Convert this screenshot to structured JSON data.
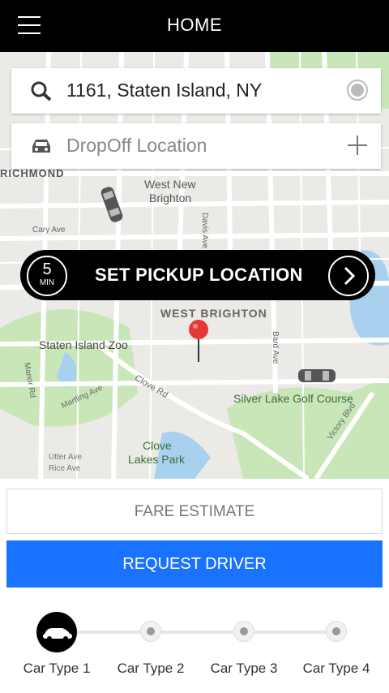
{
  "header": {
    "title": "HOME",
    "menu_icon": "hamburger-menu-icon"
  },
  "map": {
    "labels": [
      "RICHMOND",
      "West New",
      "Brighton",
      "WEST BRIGHTON",
      "Staten Island Zoo",
      "Cary Ave",
      "Davis Ave",
      "Bard Ave",
      "Clove Rd",
      "Martling Ave",
      "Manor Rd",
      "Clove",
      "Lakes Park",
      "Silver Lake Golf Course",
      "Victory Blvd",
      "Utter Ave",
      "Rice Ave"
    ],
    "colors": {
      "road": "#ffffff",
      "park": "#c9e6b8",
      "water": "#a8d1f0",
      "pin": "#e53935"
    }
  },
  "pickup_field": {
    "value": "1161, Staten Island, NY",
    "icon": "search-icon",
    "right_icon": "location-target-icon"
  },
  "dropoff_field": {
    "placeholder": "DropOff Location",
    "icon": "car-icon",
    "right_icon": "plus-icon"
  },
  "pickup_bar": {
    "eta_value": "5",
    "eta_unit": "MIN",
    "label": "SET PICKUP LOCATION",
    "icon": "chevron-right-icon"
  },
  "buttons": {
    "fare_estimate": "FARE ESTIMATE",
    "request_driver": "REQUEST DRIVER",
    "request_color": "#1a73ff"
  },
  "car_types": [
    {
      "label": "Car Type 1",
      "selected": true
    },
    {
      "label": "Car Type 2",
      "selected": false
    },
    {
      "label": "Car Type 3",
      "selected": false
    },
    {
      "label": "Car Type 4",
      "selected": false
    }
  ]
}
